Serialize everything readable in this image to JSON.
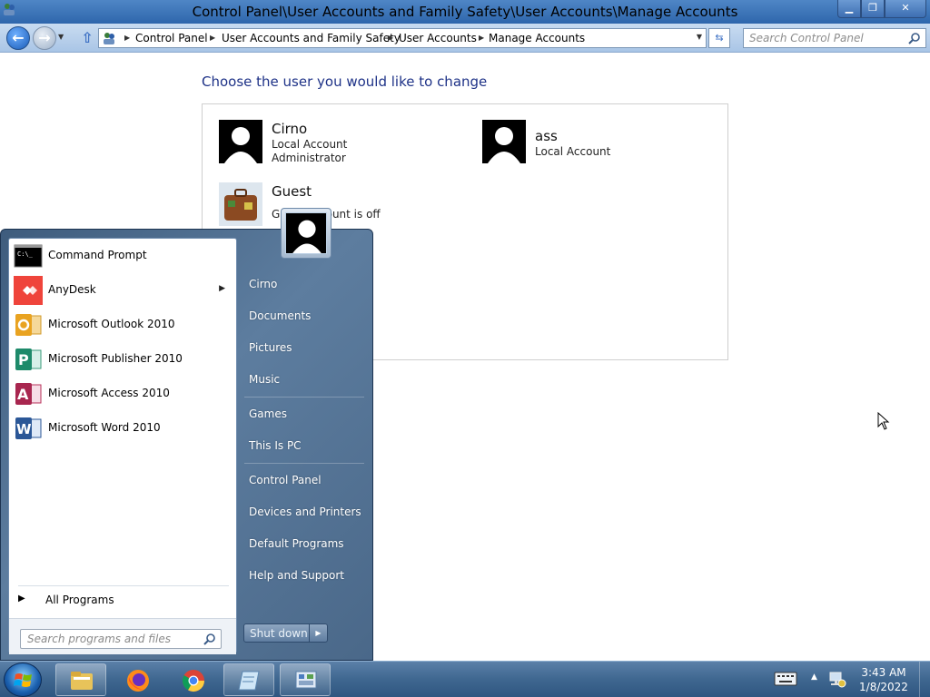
{
  "window": {
    "title": "Control Panel\\User Accounts and Family Safety\\User Accounts\\Manage Accounts"
  },
  "navbar": {
    "breadcrumbs": [
      "Control Panel",
      "User Accounts and Family Safety",
      "User Accounts",
      "Manage Accounts"
    ],
    "search_placeholder": "Search Control Panel"
  },
  "content": {
    "heading": "Choose the user you would like to change",
    "accounts": [
      {
        "name": "Cirno",
        "lines": [
          "Local Account",
          "Administrator"
        ]
      },
      {
        "name": "ass",
        "lines": [
          "Local Account"
        ]
      },
      {
        "name": "Guest",
        "lines": [
          "Guest account is off"
        ]
      }
    ]
  },
  "start_menu": {
    "programs": [
      {
        "label": "Command Prompt",
        "icon": "command-prompt-icon",
        "has_submenu": false
      },
      {
        "label": "AnyDesk",
        "icon": "anydesk-icon",
        "has_submenu": true
      },
      {
        "label": "Microsoft Outlook 2010",
        "icon": "outlook-icon",
        "has_submenu": false
      },
      {
        "label": "Microsoft Publisher 2010",
        "icon": "publisher-icon",
        "has_submenu": false
      },
      {
        "label": "Microsoft Access 2010",
        "icon": "access-icon",
        "has_submenu": false
      },
      {
        "label": "Microsoft Word 2010",
        "icon": "word-icon",
        "has_submenu": false
      }
    ],
    "all_programs": "All Programs",
    "search_placeholder": "Search programs and files",
    "right_items": [
      "Cirno",
      "Documents",
      "Pictures",
      "Music",
      "Games",
      "This Is PC",
      "Control Panel",
      "Devices and Printers",
      "Default Programs",
      "Help and Support"
    ],
    "shutdown_label": "Shut down"
  },
  "taskbar": {
    "pinned": [
      "file-explorer-icon",
      "firefox-icon",
      "chrome-icon",
      "notepad-icon",
      "control-panel-icon"
    ],
    "clock_time": "3:43 AM",
    "clock_date": "1/8/2022"
  },
  "colors": {
    "heading": "#1e3287",
    "titlebar": "#2e66ac",
    "taskbar": "#3f6790"
  }
}
